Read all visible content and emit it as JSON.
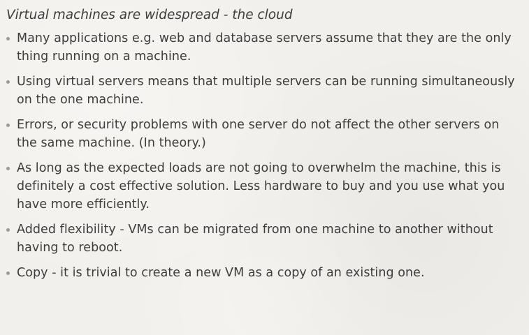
{
  "slide": {
    "subtitle": "Virtual machines are widespread - the cloud",
    "bullets": [
      "Many applications e.g. web and database servers assume that they are the only thing running on a machine.",
      "Using virtual servers means that multiple servers can be running simultaneously on the one machine.",
      "Errors, or security problems with one server do not affect the other servers on the same machine. (In theory.)",
      "As long as the expected loads are not going to overwhelm the machine, this is definitely a cost effective solution. Less hardware to buy and you use what you have more efficiently.",
      "Added flexibility - VMs can be migrated from one machine to another without having to reboot.",
      "Copy - it is trivial to create a new VM as a copy of an existing one."
    ]
  }
}
